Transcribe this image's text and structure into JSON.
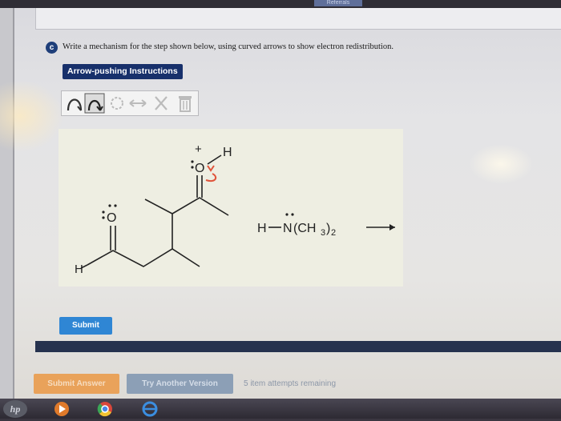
{
  "browser": {
    "tab_label": "Referrals"
  },
  "question": {
    "badge": "c",
    "text": "Write a mechanism for the step shown below, using curved arrows to show electron redistribution."
  },
  "instructions_button": "Arrow-pushing Instructions",
  "toolbar": {
    "tools": [
      "single-barb-arrow-icon",
      "double-barb-arrow-icon",
      "lasso-icon",
      "resonance-arrow-icon",
      "delete-x-icon",
      "trash-icon"
    ]
  },
  "molecule": {
    "plus_charge": "+",
    "oxonium_o": "O",
    "oxonium_h": "H",
    "aldehyde_o": "O",
    "aldehyde_h": "H",
    "amine_h": "H",
    "amine_n": "N",
    "amine_group": "(CH",
    "amine_sub": "3",
    "amine_close": ")",
    "amine_sub2": "2",
    "arrow_color": "#e0533a"
  },
  "buttons": {
    "submit": "Submit",
    "submit_answer": "Submit Answer",
    "try_another": "Try Another Version"
  },
  "attempts_text": "5 item attempts remaining",
  "taskbar": {
    "logo": "hp"
  }
}
